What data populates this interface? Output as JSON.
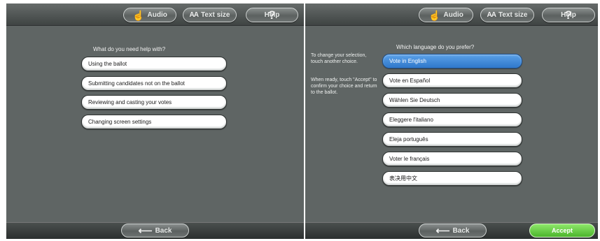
{
  "toolbar": {
    "audio_label": "Audio",
    "text_size_icon": "AA",
    "text_size_label": "Text size",
    "help_label": "Help",
    "icons": [
      "hand-touch-icon",
      "text-size-icon",
      "question-icon",
      "arrow-left-icon"
    ]
  },
  "help_screen": {
    "question": "What do you need help with?",
    "options": [
      "Using the ballot",
      "Submitting candidates not on the ballot",
      "Reviewing and casting your votes",
      "Changing screen settings"
    ],
    "back_label": "Back"
  },
  "language_screen": {
    "instructions_1": "To change your selection, touch another choice.",
    "instructions_2": "When ready, touch \"Accept\" to confirm your choice and return to the ballot.",
    "question": "Which language do you prefer?",
    "options": [
      "Vote in English",
      "Vote en Español",
      "Wählen Sie Deutsch",
      "Eleggere l'italiano",
      "Eleja português",
      "Voter le français",
      "表决用中文"
    ],
    "selected_index": 0,
    "back_label": "Back",
    "accept_label": "Accept"
  },
  "colors": {
    "background": "#5f6564",
    "selected": "#3d86d6",
    "accept": "#5fc23b"
  }
}
